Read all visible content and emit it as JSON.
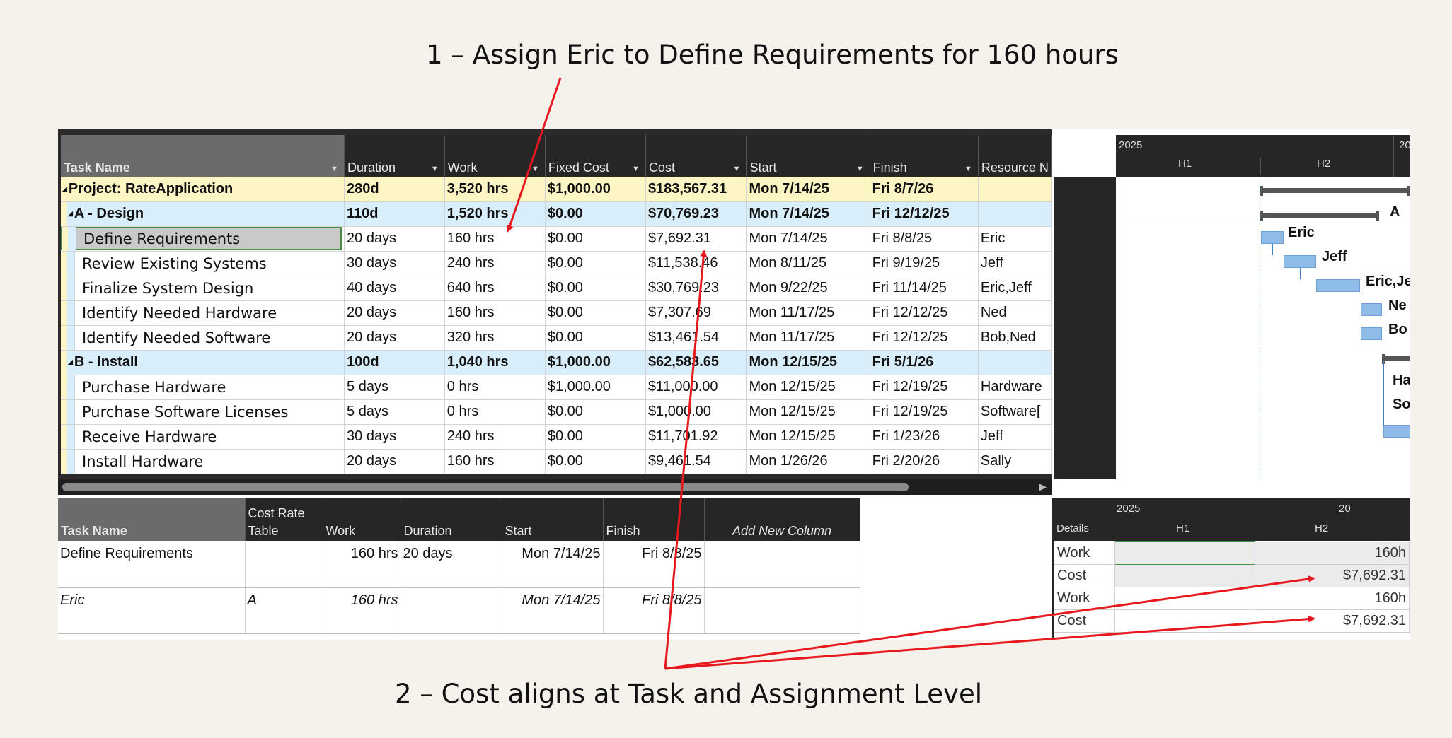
{
  "annotations": {
    "step1": "1 – Assign Eric to Define Requirements for 160 hours",
    "step2": "2 – Cost aligns at Task and Assignment Level"
  },
  "task_grid": {
    "columns": [
      "Task Name",
      "Duration",
      "Work",
      "Fixed Cost",
      "Cost",
      "Start",
      "Finish",
      "Resource N"
    ],
    "rows": [
      {
        "type": "project",
        "name": "Project: RateApplication",
        "duration": "280d",
        "work": "3,520 hrs",
        "fixed_cost": "$1,000.00",
        "cost": "$183,567.31",
        "start": "Mon 7/14/25",
        "finish": "Fri 8/7/26",
        "resource": ""
      },
      {
        "type": "summary",
        "name": "A - Design",
        "duration": "110d",
        "work": "1,520 hrs",
        "fixed_cost": "$0.00",
        "cost": "$70,769.23",
        "start": "Mon 7/14/25",
        "finish": "Fri 12/12/25",
        "resource": ""
      },
      {
        "type": "task",
        "selected": true,
        "name": "Define Requirements",
        "duration": "20 days",
        "work": "160 hrs",
        "fixed_cost": "$0.00",
        "cost": "$7,692.31",
        "start": "Mon 7/14/25",
        "finish": "Fri 8/8/25",
        "resource": "Eric"
      },
      {
        "type": "task",
        "name": "Review Existing Systems",
        "duration": "30 days",
        "work": "240 hrs",
        "fixed_cost": "$0.00",
        "cost": "$11,538.46",
        "start": "Mon 8/11/25",
        "finish": "Fri 9/19/25",
        "resource": "Jeff"
      },
      {
        "type": "task",
        "name": "Finalize System Design",
        "duration": "40 days",
        "work": "640 hrs",
        "fixed_cost": "$0.00",
        "cost": "$30,769.23",
        "start": "Mon 9/22/25",
        "finish": "Fri 11/14/25",
        "resource": "Eric,Jeff"
      },
      {
        "type": "task",
        "name": "Identify Needed Hardware",
        "duration": "20 days",
        "work": "160 hrs",
        "fixed_cost": "$0.00",
        "cost": "$7,307.69",
        "start": "Mon 11/17/25",
        "finish": "Fri 12/12/25",
        "resource": "Ned"
      },
      {
        "type": "task",
        "name": "Identify Needed Software",
        "duration": "20 days",
        "work": "320 hrs",
        "fixed_cost": "$0.00",
        "cost": "$13,461.54",
        "start": "Mon 11/17/25",
        "finish": "Fri 12/12/25",
        "resource": "Bob,Ned"
      },
      {
        "type": "summary",
        "name": "B - Install",
        "duration": "100d",
        "work": "1,040 hrs",
        "fixed_cost": "$1,000.00",
        "cost": "$62,583.65",
        "start": "Mon 12/15/25",
        "finish": "Fri 5/1/26",
        "resource": ""
      },
      {
        "type": "task",
        "name": "Purchase Hardware",
        "duration": "5 days",
        "work": "0 hrs",
        "fixed_cost": "$1,000.00",
        "cost": "$11,000.00",
        "start": "Mon 12/15/25",
        "finish": "Fri 12/19/25",
        "resource": "Hardware"
      },
      {
        "type": "task",
        "name": "Purchase Software Licenses",
        "duration": "5 days",
        "work": "0 hrs",
        "fixed_cost": "$0.00",
        "cost": "$1,000.00",
        "start": "Mon 12/15/25",
        "finish": "Fri 12/19/25",
        "resource": "Software["
      },
      {
        "type": "task",
        "name": "Receive Hardware",
        "duration": "30 days",
        "work": "240 hrs",
        "fixed_cost": "$0.00",
        "cost": "$11,701.92",
        "start": "Mon 12/15/25",
        "finish": "Fri 1/23/26",
        "resource": "Jeff"
      },
      {
        "type": "task",
        "name": "Install Hardware",
        "duration": "20 days",
        "work": "160 hrs",
        "fixed_cost": "$0.00",
        "cost": "$9,461.54",
        "start": "Mon 1/26/26",
        "finish": "Fri 2/20/26",
        "resource": "Sally"
      }
    ]
  },
  "gantt": {
    "year": "2025",
    "year_next": "20",
    "half1": "H1",
    "half2": "H2",
    "labels": [
      "A",
      "Eric",
      "Jeff",
      "Eric,Je",
      "Ne",
      "Bo",
      "Ha",
      "So"
    ]
  },
  "usage_grid": {
    "columns": [
      "Task Name",
      "Cost Rate\nTable",
      "Work",
      "Duration",
      "Start",
      "Finish",
      "Add New Column"
    ],
    "column_line1": "Cost Rate",
    "column_line2": "Table",
    "task_row": {
      "name": "Define Requirements",
      "rate_table": "",
      "work": "160 hrs",
      "duration": "20 days",
      "start": "Mon 7/14/25",
      "finish": "Fri 8/8/25"
    },
    "assignment_row": {
      "name": "Eric",
      "rate_table": "A",
      "work": "160 hrs",
      "duration": "",
      "start": "Mon 7/14/25",
      "finish": "Fri 8/8/25"
    }
  },
  "timephased": {
    "year": "2025",
    "year_next": "20",
    "details_label": "Details",
    "half1": "H1",
    "half2": "H2",
    "rows": [
      {
        "label": "Work",
        "h1": "",
        "h2": "160h"
      },
      {
        "label": "Cost",
        "h1": "",
        "h2": "$7,692.31"
      },
      {
        "label": "Work",
        "h1": "",
        "h2": "160h"
      },
      {
        "label": "Cost",
        "h1": "",
        "h2": "$7,692.31"
      }
    ]
  },
  "colors": {
    "background": "#f5f1eb",
    "arrow": "#e8191e",
    "project_row": "#fdf5c3",
    "summary_row": "#d8eefa",
    "gantt_bar": "#8fbbe8",
    "header": "#262626"
  }
}
